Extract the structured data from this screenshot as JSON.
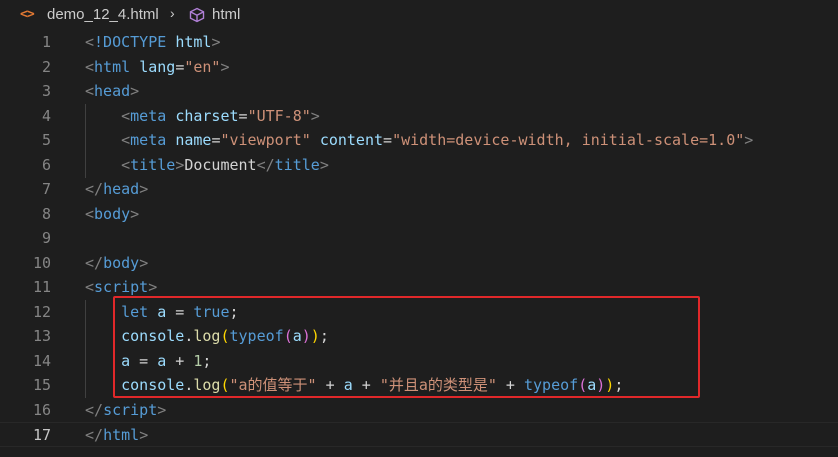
{
  "breadcrumb": {
    "file_icon": "html-file-icon",
    "file_icon_glyph": "<>",
    "file_name": "demo_12_4.html",
    "separator": "›",
    "symbol_icon": "cube-symbol-icon",
    "symbol_name": "html"
  },
  "colors": {
    "background": "#1e1e1e",
    "tag": "#569cd6",
    "attribute": "#9cdcfe",
    "string": "#ce9178",
    "function": "#dcdcaa",
    "number": "#b5cea8",
    "highlight_box": "#e0282a"
  },
  "editor": {
    "active_line": 17,
    "lines": [
      {
        "n": "1",
        "tokens": [
          [
            "t-punc",
            "<"
          ],
          [
            "t-tag",
            "!DOCTYPE"
          ],
          [
            "t-text",
            " "
          ],
          [
            "t-attr",
            "html"
          ],
          [
            "t-punc",
            ">"
          ]
        ]
      },
      {
        "n": "2",
        "tokens": [
          [
            "t-punc",
            "<"
          ],
          [
            "t-tag",
            "html"
          ],
          [
            "t-text",
            " "
          ],
          [
            "t-attr",
            "lang"
          ],
          [
            "t-text",
            "="
          ],
          [
            "t-str",
            "\"en\""
          ],
          [
            "t-punc",
            ">"
          ]
        ]
      },
      {
        "n": "3",
        "tokens": [
          [
            "t-punc",
            "<"
          ],
          [
            "t-tag",
            "head"
          ],
          [
            "t-punc",
            ">"
          ]
        ]
      },
      {
        "n": "4",
        "tokens": [
          [
            "t-text",
            "    "
          ],
          [
            "t-punc",
            "<"
          ],
          [
            "t-tag",
            "meta"
          ],
          [
            "t-text",
            " "
          ],
          [
            "t-attr",
            "charset"
          ],
          [
            "t-text",
            "="
          ],
          [
            "t-str",
            "\"UTF-8\""
          ],
          [
            "t-punc",
            ">"
          ]
        ]
      },
      {
        "n": "5",
        "tokens": [
          [
            "t-text",
            "    "
          ],
          [
            "t-punc",
            "<"
          ],
          [
            "t-tag",
            "meta"
          ],
          [
            "t-text",
            " "
          ],
          [
            "t-attr",
            "name"
          ],
          [
            "t-text",
            "="
          ],
          [
            "t-str",
            "\"viewport\""
          ],
          [
            "t-text",
            " "
          ],
          [
            "t-attr",
            "content"
          ],
          [
            "t-text",
            "="
          ],
          [
            "t-str",
            "\"width=device-width, initial-scale=1.0\""
          ],
          [
            "t-punc",
            ">"
          ]
        ]
      },
      {
        "n": "6",
        "tokens": [
          [
            "t-text",
            "    "
          ],
          [
            "t-punc",
            "<"
          ],
          [
            "t-tag",
            "title"
          ],
          [
            "t-punc",
            ">"
          ],
          [
            "t-text",
            "Document"
          ],
          [
            "t-punc",
            "</"
          ],
          [
            "t-tag",
            "title"
          ],
          [
            "t-punc",
            ">"
          ]
        ]
      },
      {
        "n": "7",
        "tokens": [
          [
            "t-punc",
            "</"
          ],
          [
            "t-tag",
            "head"
          ],
          [
            "t-punc",
            ">"
          ]
        ]
      },
      {
        "n": "8",
        "tokens": [
          [
            "t-punc",
            "<"
          ],
          [
            "t-tag",
            "body"
          ],
          [
            "t-punc",
            ">"
          ]
        ]
      },
      {
        "n": "9",
        "tokens": []
      },
      {
        "n": "10",
        "tokens": [
          [
            "t-punc",
            "</"
          ],
          [
            "t-tag",
            "body"
          ],
          [
            "t-punc",
            ">"
          ]
        ]
      },
      {
        "n": "11",
        "tokens": [
          [
            "t-punc",
            "<"
          ],
          [
            "t-tag",
            "script"
          ],
          [
            "t-punc",
            ">"
          ]
        ]
      },
      {
        "n": "12",
        "tokens": [
          [
            "t-text",
            "    "
          ],
          [
            "t-kw",
            "let"
          ],
          [
            "t-text",
            " "
          ],
          [
            "t-var",
            "a"
          ],
          [
            "t-op",
            " = "
          ],
          [
            "t-kw",
            "true"
          ],
          [
            "t-text",
            ";"
          ]
        ]
      },
      {
        "n": "13",
        "tokens": [
          [
            "t-text",
            "    "
          ],
          [
            "t-var",
            "console"
          ],
          [
            "t-text",
            "."
          ],
          [
            "t-fn",
            "log"
          ],
          [
            "t-br1",
            "("
          ],
          [
            "t-kw",
            "typeof"
          ],
          [
            "t-br2",
            "("
          ],
          [
            "t-var",
            "a"
          ],
          [
            "t-br2",
            ")"
          ],
          [
            "t-br1",
            ")"
          ],
          [
            "t-text",
            ";"
          ]
        ]
      },
      {
        "n": "14",
        "tokens": [
          [
            "t-text",
            "    "
          ],
          [
            "t-var",
            "a"
          ],
          [
            "t-op",
            " = "
          ],
          [
            "t-var",
            "a"
          ],
          [
            "t-op",
            " + "
          ],
          [
            "t-num",
            "1"
          ],
          [
            "t-text",
            ";"
          ]
        ]
      },
      {
        "n": "15",
        "tokens": [
          [
            "t-text",
            "    "
          ],
          [
            "t-var",
            "console"
          ],
          [
            "t-text",
            "."
          ],
          [
            "t-fn",
            "log"
          ],
          [
            "t-br1",
            "("
          ],
          [
            "t-str",
            "\"a的值等于\""
          ],
          [
            "t-op",
            " + "
          ],
          [
            "t-var",
            "a"
          ],
          [
            "t-op",
            " + "
          ],
          [
            "t-str",
            "\"并且a的类型是\""
          ],
          [
            "t-op",
            " + "
          ],
          [
            "t-kw",
            "typeof"
          ],
          [
            "t-br2",
            "("
          ],
          [
            "t-var",
            "a"
          ],
          [
            "t-br2",
            ")"
          ],
          [
            "t-br1",
            ")"
          ],
          [
            "t-text",
            ";"
          ]
        ]
      },
      {
        "n": "16",
        "tokens": [
          [
            "t-punc",
            "</"
          ],
          [
            "t-tag",
            "script"
          ],
          [
            "t-punc",
            ">"
          ]
        ]
      },
      {
        "n": "17",
        "tokens": [
          [
            "t-punc",
            "</"
          ],
          [
            "t-tag",
            "html"
          ],
          [
            "t-punc",
            ">"
          ]
        ]
      }
    ]
  }
}
